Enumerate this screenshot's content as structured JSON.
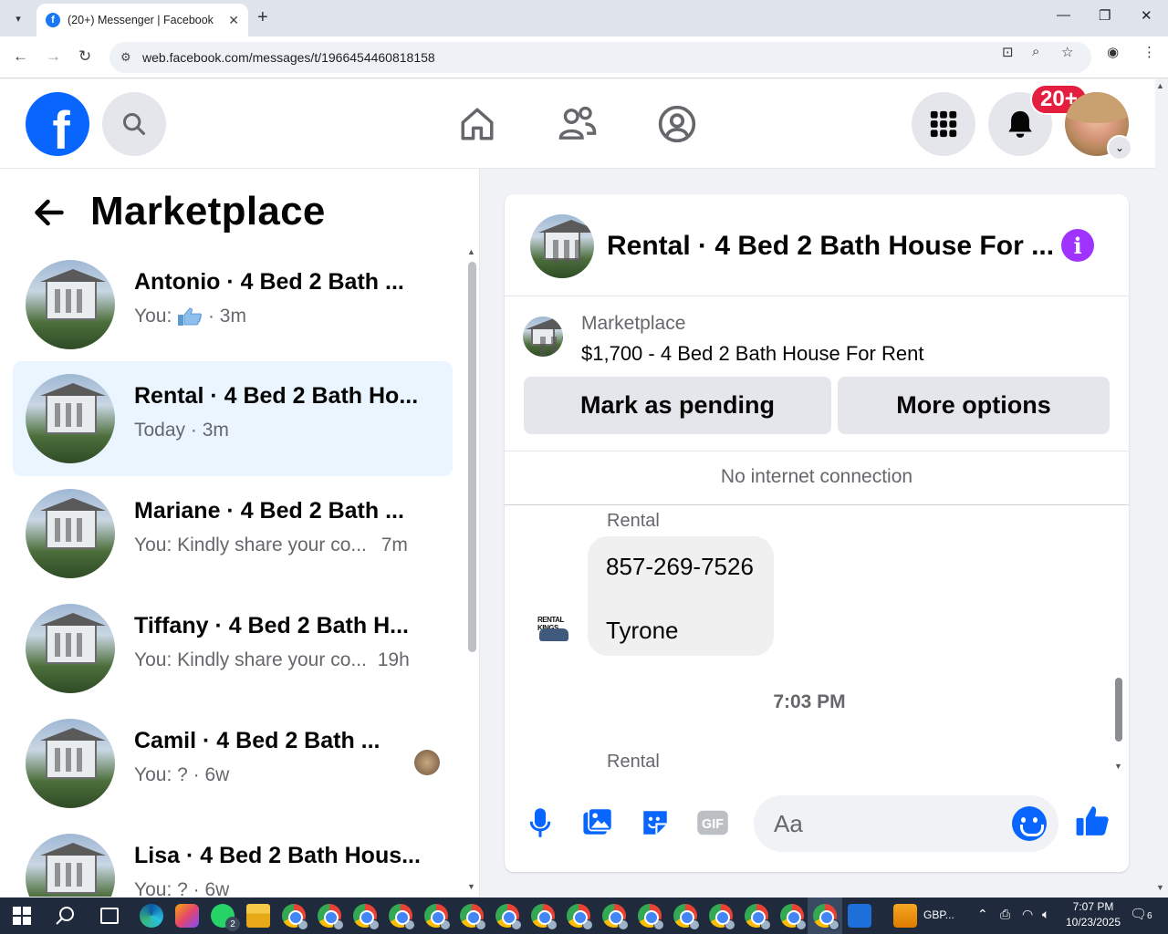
{
  "browser": {
    "tab_title": "(20+) Messenger | Facebook",
    "url": "web.facebook.com/messages/t/1966454460818158"
  },
  "header": {
    "notification_badge": "20+",
    "logo_letter": "f"
  },
  "left_panel": {
    "title": "Marketplace",
    "conversations": [
      {
        "name": "Antonio · 4 Bed 2 Bath ...",
        "preview_prefix": "You:",
        "preview": "",
        "time": "· 3m",
        "has_like": true,
        "active": false
      },
      {
        "name": "Rental · 4 Bed 2 Bath Ho...",
        "preview_prefix": "",
        "preview": "Today",
        "time": "· 3m",
        "has_like": false,
        "active": true
      },
      {
        "name": "Mariane · 4 Bed 2 Bath ...",
        "preview_prefix": "",
        "preview": "You: Kindly share your co...",
        "time": "7m",
        "has_like": false,
        "active": false
      },
      {
        "name": "Tiffany · 4 Bed 2 Bath H...",
        "preview_prefix": "",
        "preview": "You: Kindly share your co...",
        "time": "19h",
        "has_like": false,
        "active": false
      },
      {
        "name": "Camil · 4 Bed 2 Bath ...",
        "preview_prefix": "",
        "preview": "You: ?",
        "time": "· 6w",
        "has_like": false,
        "active": false
      },
      {
        "name": "Lisa · 4 Bed 2 Bath Hous...",
        "preview_prefix": "",
        "preview": "You: ?",
        "time": "· 6w",
        "has_like": false,
        "active": false
      }
    ]
  },
  "chat": {
    "title": "Rental · 4 Bed 2 Bath House For ...",
    "marketplace_label": "Marketplace",
    "listing": "$1,700 - 4 Bed 2 Bath House For Rent",
    "mark_pending_label": "Mark as pending",
    "more_options_label": "More options",
    "status": "No internet connection",
    "messages": [
      {
        "sender": "Rental",
        "line1": "857-269-7526",
        "line2": "Tyrone"
      }
    ],
    "timestamp": "7:03 PM",
    "next_sender": "Rental",
    "avatar_text": "RENTAL KINGS",
    "composer_placeholder": "Aa"
  },
  "taskbar": {
    "app_label": "GBP...",
    "time": "7:07 PM",
    "date": "10/23/2025",
    "notification_count": "6",
    "whatsapp_badge": "2"
  },
  "colors": {
    "fb_blue": "#0866ff",
    "active_row": "#ebf5ff",
    "badge_red": "#e41e3f",
    "info_purple": "#a033ff"
  }
}
